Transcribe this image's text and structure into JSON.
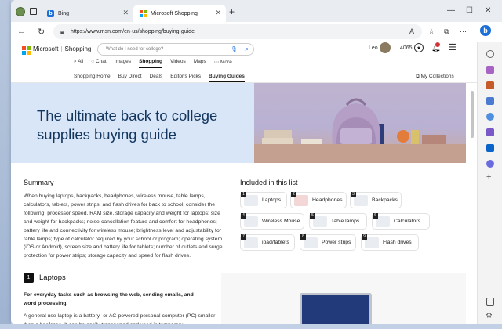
{
  "browser": {
    "tabs": [
      {
        "label": "Bing",
        "favicon": "b"
      },
      {
        "label": "Microsoft Shopping",
        "favicon": "msft"
      }
    ],
    "url": "https://www.msn.com/en-us/shopping/buying-guide"
  },
  "header": {
    "brand": "Microsoft",
    "section": "Shopping",
    "search_placeholder": "What do I need for college?",
    "user_name": "Leo",
    "points": "4065"
  },
  "verticals": [
    "All",
    "Chat",
    "Images",
    "Shopping",
    "Videos",
    "Maps",
    "More"
  ],
  "subnav": {
    "items": [
      "Shopping Home",
      "Buy Direct",
      "Deals",
      "Editor's Picks",
      "Buying Guides"
    ],
    "collections": "My Collections"
  },
  "hero": {
    "title": "The ultimate back to college supplies buying guide"
  },
  "summary": {
    "heading": "Summary",
    "text": "When buying laptops, backpacks, headphones, wireless mouse, table lamps, calculators, tablets, power strips, and flash drives for back to school, consider the following: processor speed, RAM size, storage capacity and weight for laptops; size and weight for backpacks; noise-cancellation feature and comfort for headphones; battery life and connectivity for wireless mouse; brightness level and adjustability for table lamps; type of calculator required by your school or program; operating system (iOS or Android), screen size and battery life for tablets; number of outlets and surge protection for power strips; storage capacity and speed for flash drives."
  },
  "included": {
    "heading": "Included in this list",
    "items": [
      {
        "num": "1",
        "label": "Laptops"
      },
      {
        "num": "2",
        "label": "Headphones"
      },
      {
        "num": "3",
        "label": "Backpacks"
      },
      {
        "num": "4",
        "label": "Wireless Mouse"
      },
      {
        "num": "5",
        "label": "Table lamps"
      },
      {
        "num": "6",
        "label": "Calculators"
      },
      {
        "num": "7",
        "label": "ipad/tablets"
      },
      {
        "num": "8",
        "label": "Power strips"
      },
      {
        "num": "9",
        "label": "Flash drives"
      }
    ]
  },
  "laptops_section": {
    "num": "1",
    "heading": "Laptops",
    "tagline": "For everyday tasks such as browsing the web, sending emails, and word processing.",
    "text": "A general use laptop is a battery- or AC-powered personal computer (PC) smaller than a briefcase. It can be easily transported and used in temporary"
  },
  "colors": {
    "hero_bg": "#d9e6f8",
    "hero_title": "#12365e",
    "accent": "#1b6fd8"
  }
}
